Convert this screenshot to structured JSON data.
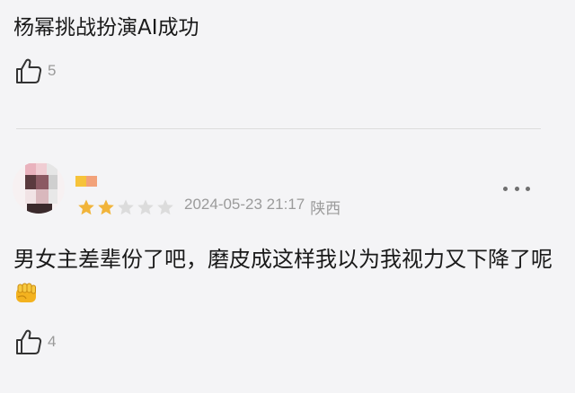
{
  "comment1": {
    "text": "杨幂挑战扮演AI成功",
    "likes": "5"
  },
  "comment2": {
    "rating": 2,
    "rating_max": 5,
    "date": "2024-05-23 21:17",
    "location": "陕西",
    "text": "男女主差辈份了吧，磨皮成这样我以为我视力又下降了呢",
    "emoji": "fist-emoji",
    "likes": "4"
  },
  "icons": {
    "like": "thumbs-up-icon",
    "more": "more-horizontal-icon",
    "star": "star-icon"
  },
  "colors": {
    "star_filled": "#f1b43a",
    "star_empty": "#dcdcdc",
    "text": "#1a1a1a",
    "muted": "#9b9b9b"
  }
}
